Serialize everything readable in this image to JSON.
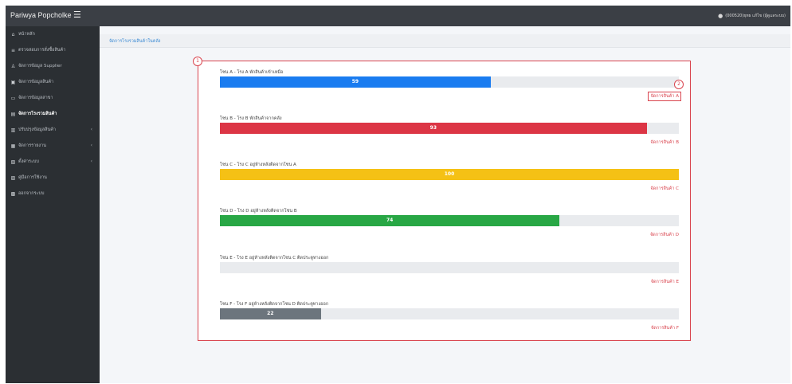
{
  "header": {
    "brand": "Pariwya Popcholke",
    "menu_icon": "☰",
    "user_text": "(000520)ยุทธ แก้ไข (ผู้ดูแลระบบ)"
  },
  "sidebar": {
    "items": [
      {
        "icon": "home-icon",
        "glyph": "⌂",
        "label": "หน้าหลัก"
      },
      {
        "icon": "list-icon",
        "glyph": "≡",
        "label": "ตรวจสอบการสั่งซื้อสินค้า"
      },
      {
        "icon": "user-icon",
        "glyph": "♙",
        "label": "จัดการข้อมูล Supplier"
      },
      {
        "icon": "box-icon",
        "glyph": "▣",
        "label": "จัดการข้อมูลสินค้า"
      },
      {
        "icon": "monitor-icon",
        "glyph": "▭",
        "label": "จัดการข้อมูลสาขา"
      },
      {
        "icon": "store-icon",
        "glyph": "▤",
        "label": "จัดการโรงรวมสินค้า"
      },
      {
        "icon": "document-icon",
        "glyph": "▥",
        "label": "ปรับปรุงข้อมูลสินค้า",
        "has_children": true
      },
      {
        "icon": "chart-icon",
        "glyph": "▦",
        "label": "จัดการรายงาน",
        "has_children": true
      },
      {
        "icon": "settings-icon",
        "glyph": "▧",
        "label": "ตั้งค่าระบบ",
        "has_children": true
      },
      {
        "icon": "file-icon",
        "glyph": "▨",
        "label": "คู่มือการใช้งาน"
      },
      {
        "icon": "logout-icon",
        "glyph": "▩",
        "label": "ออกจากระบบ"
      }
    ],
    "active_index": 5
  },
  "breadcrumb": "จัดการโรงรวมสินค้าในคลัง",
  "callouts": [
    "1",
    "2"
  ],
  "zones": [
    {
      "title": "โซน A - โรง A พักสินค้าเข้าเหมือ",
      "value": 59,
      "percent": 59,
      "color": "#1a7cf0",
      "link": "จัดการสินค้า A"
    },
    {
      "title": "โซน B - โรง B พักสินค้าจากคลัง",
      "value": 93,
      "percent": 93,
      "color": "#dc3545",
      "link": "จัดการสินค้า B"
    },
    {
      "title": "โซน C - โรง C อยู่ห้างหลังติดจากโซน A",
      "value": 100,
      "percent": 100,
      "color": "#f5c115",
      "link": "จัดการสินค้า C"
    },
    {
      "title": "โซน D - โรง D อยู่ห้างหลังติดจากโซน B",
      "value": 74,
      "percent": 74,
      "color": "#28a745",
      "link": "จัดการสินค้า D"
    },
    {
      "title": "โซน E - โรง E อยู่ห้างหลังติดจากโซน C ติดประตูทางออก",
      "value": "",
      "percent": 0,
      "color": "#6c757d",
      "link": "จัดการสินค้า E"
    },
    {
      "title": "โซน F - โรง F อยู่ห้างหลังติดจากโซน D ติดประตูทางออก",
      "value": 22,
      "percent": 22,
      "color": "#6c757d",
      "link": "จัดการสินค้า F"
    }
  ]
}
